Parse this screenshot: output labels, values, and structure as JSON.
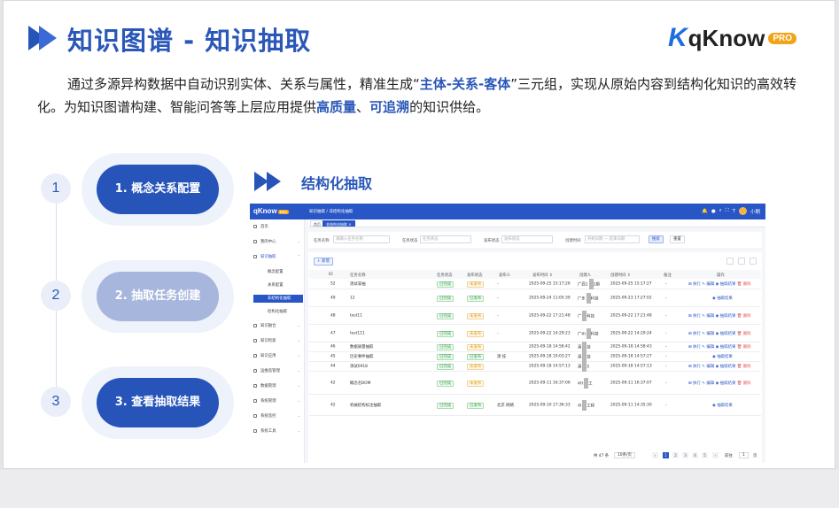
{
  "header": {
    "title": "知识图谱 - 知识抽取",
    "logo": {
      "text": "qKnow",
      "badge": "PRO"
    }
  },
  "intro": {
    "p1": "通过多源异构数据中自动识别实体、关系与属性，精准生成“",
    "hl1": "主体-关系-客体",
    "p2": "”三元组，实现从原始内容到结构化知识的高效转化。为知识图谱构建、智能问答等上层应用提供",
    "hl2": "高质量",
    "p3": "、",
    "hl3": "可追溯",
    "p4": "的知识供给。"
  },
  "steps": [
    {
      "num": "1",
      "label": "1. 概念关系配置",
      "state": "active"
    },
    {
      "num": "2",
      "label": "2. 抽取任务创建",
      "state": "inactive"
    },
    {
      "num": "3",
      "label": "3. 查看抽取结果",
      "state": "active"
    }
  ],
  "section_title": "结构化抽取",
  "app": {
    "logo": "qKnow",
    "logo_badge": "PRO",
    "breadcrumb": "知识抽取  /  非结构化抽取",
    "user": "小刚",
    "tabs": [
      "首页",
      "非结构化抽取 ×"
    ],
    "sidebar": [
      {
        "label": "首页",
        "kind": "item"
      },
      {
        "label": "我的中心",
        "kind": "item"
      },
      {
        "label": "知识抽取",
        "kind": "item"
      },
      {
        "label": "概念配置",
        "kind": "sub"
      },
      {
        "label": "关系配置",
        "kind": "sub"
      },
      {
        "label": "非结构化抽取",
        "kind": "sub",
        "active": true
      },
      {
        "label": "结构化抽取",
        "kind": "sub"
      },
      {
        "label": "知识融合",
        "kind": "item"
      },
      {
        "label": "知识检索",
        "kind": "item"
      },
      {
        "label": "知识应用",
        "kind": "item"
      },
      {
        "label": "运维监管理",
        "kind": "item"
      },
      {
        "label": "数据管理",
        "kind": "item"
      },
      {
        "label": "系统管理",
        "kind": "item"
      },
      {
        "label": "系统监控",
        "kind": "item"
      },
      {
        "label": "系统工具",
        "kind": "item"
      }
    ],
    "filter": {
      "task_name_label": "任务名称",
      "task_name_placeholder": "请输入任务名称",
      "task_status_label": "任务状态",
      "task_status_placeholder": "任务状态",
      "publish_status_label": "发布状态",
      "publish_status_placeholder": "发布状态",
      "create_time_label": "创建时间",
      "date_start": "开始日期",
      "date_sep": "—",
      "date_end": "结束日期",
      "search": "搜索",
      "reset": "重置"
    },
    "add_button": "+ 新增",
    "columns": [
      "ID",
      "任务名称",
      "任务状态",
      "发布状态",
      "发布人",
      "发布时间 ⇕",
      "创建人",
      "创建时间 ⇕",
      "备注",
      "操作"
    ],
    "rows": [
      {
        "id": "52",
        "name": "测试非抽",
        "status": "已完成",
        "pub": "未发布",
        "publisher": "-",
        "pub_time": "2025-09-25 15:17:26",
        "creator": "广西1",
        "creator2": "1期",
        "created": "2025-09-25 15:17:27",
        "note": "-",
        "ops": "full"
      },
      {
        "id": "49",
        "name": "12",
        "status": "已完成",
        "pub": "已发布",
        "publisher": "-",
        "pub_time": "2025-09-24 11:05:39",
        "creator": "广东",
        "creator2": "科技",
        "created": "2025-09-23 17:27:02",
        "note": "-",
        "ops": "view"
      },
      {
        "id": "48",
        "name": "test11",
        "status": "已完成",
        "pub": "未发布",
        "publisher": "-",
        "pub_time": "2025-09-22 17:21:48",
        "creator": "广",
        "creator2": "科技",
        "created": "2025-09-22 17:21:48",
        "note": "-",
        "ops": "full"
      },
      {
        "id": "47",
        "name": "test111",
        "status": "已完成",
        "pub": "未发布",
        "publisher": "-",
        "pub_time": "2025-09-22 14:29:23",
        "creator": "广州",
        "creator2": "科技",
        "created": "2025-09-22 14:29:24",
        "note": "-",
        "ops": "full"
      },
      {
        "id": "46",
        "name": "数据质量抽取",
        "status": "已完成",
        "pub": "未发布",
        "publisher": "",
        "pub_time": "2025-09-18 14:58:42",
        "creator": "演",
        "creator2": "技",
        "created": "2025-09-18 14:58:43",
        "note": "-",
        "ops": "full"
      },
      {
        "id": "45",
        "name": "历史事件抽取",
        "status": "已完成",
        "pub": "已发布",
        "publisher": "演  技",
        "pub_time": "2025-09-18 10:03:27",
        "creator": "演",
        "creator2": "技",
        "created": "2025-09-18 14:57:27",
        "note": "-",
        "ops": "view"
      },
      {
        "id": "44",
        "name": "测试0918",
        "status": "已完成",
        "pub": "未发布",
        "publisher": "",
        "pub_time": "2025-09-18 14:57:13",
        "creator": "演",
        "creator2": "5",
        "created": "2025-09-18 14:57:13",
        "note": "-",
        "ops": "full"
      },
      {
        "id": "42",
        "name": "概念名BOM",
        "status": "已完成",
        "pub": "未发布",
        "publisher": "",
        "pub_time": "2025-09-11 16:37:06",
        "creator": "4H",
        "creator2": "工",
        "created": "2025-09-11 16:37:07",
        "note": "-",
        "ops": "full"
      },
      {
        "id": "42",
        "name": "机械结构标注抽取",
        "status": "已完成",
        "pub": "已发布",
        "publisher": "北京  网络",
        "pub_time": "2025-09-10 17:36:33",
        "creator": "AI",
        "creator2": "工程",
        "created": "2025-09-11 14:35:30",
        "note": "-",
        "ops": "view"
      }
    ],
    "ops": {
      "exec": "执行",
      "edit": "编辑",
      "result": "抽取结果",
      "del": "删除"
    },
    "pagination": {
      "total": "共 47 条",
      "size": "10条/页",
      "pages": [
        "1",
        "2",
        "3",
        "4",
        "5"
      ],
      "goto": "前往",
      "goto_page": "1",
      "page_unit": "页"
    }
  }
}
